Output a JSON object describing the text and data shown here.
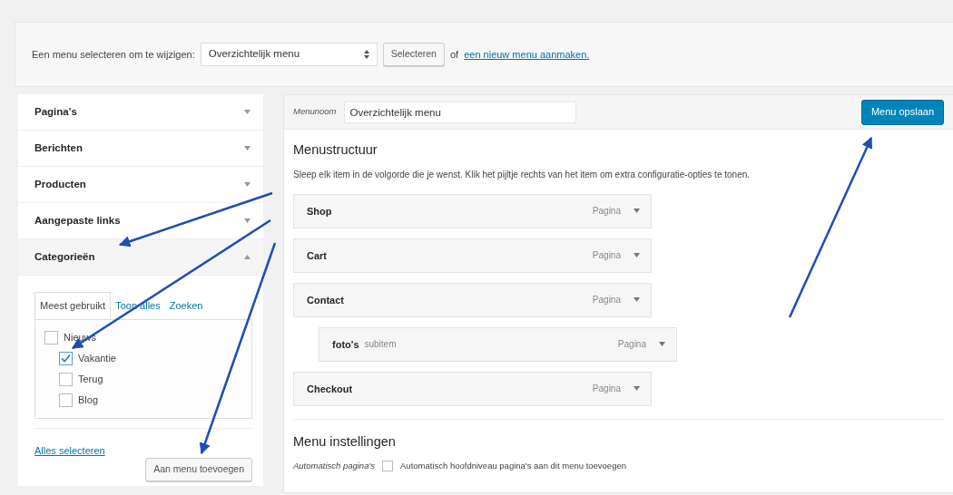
{
  "menu_select": {
    "label": "Een menu selecteren om te wijzigen:",
    "value": "Overzichtelijk menu",
    "button": "Selecteren",
    "or_text": "of",
    "create_link": "een nieuw menu aanmaken."
  },
  "sidebar": {
    "sections": [
      {
        "title": "Pagina's",
        "expanded": false
      },
      {
        "title": "Berichten",
        "expanded": false
      },
      {
        "title": "Producten",
        "expanded": false
      },
      {
        "title": "Aangepaste links",
        "expanded": false
      },
      {
        "title": "Categorieën",
        "expanded": true
      }
    ],
    "tabs": [
      {
        "label": "Meest gebruikt",
        "selected": true
      },
      {
        "label": "Toon alles",
        "selected": false
      },
      {
        "label": "Zoeken",
        "selected": false
      }
    ],
    "categories": [
      {
        "label": "Nieuws",
        "checked": false,
        "children": [
          {
            "label": "Vakantie",
            "checked": true
          },
          {
            "label": "Terug",
            "checked": false
          },
          {
            "label": "Blog",
            "checked": false
          }
        ]
      }
    ],
    "select_all": "Alles selecteren",
    "add_button": "Aan menu toevoegen"
  },
  "editor": {
    "name_label": "Menunoom",
    "name_value": "Overzichtelijk menu",
    "save_button": "Menu opslaan",
    "structure_title": "Menustructuur",
    "structure_hint": "Sleep elk item in de volgorde die je wenst. Klik het pijltje rechts van het item om extra configuratie-opties te tonen.",
    "items": [
      {
        "title": "Shop",
        "type": "Pagina"
      },
      {
        "title": "Cart",
        "type": "Pagina"
      },
      {
        "title": "Contact",
        "type": "Pagina",
        "children": [
          {
            "title": "foto's",
            "sub_label": "subitem",
            "type": "Pagina"
          }
        ]
      },
      {
        "title": "Checkout",
        "type": "Pagina"
      }
    ],
    "settings_title": "Menu instellingen",
    "settings_row_label": "Automatisch pagina's",
    "settings_checkbox_label": "Automatisch hoofdniveau pagina's aan dit menu toevoegen",
    "settings_checked": false
  }
}
